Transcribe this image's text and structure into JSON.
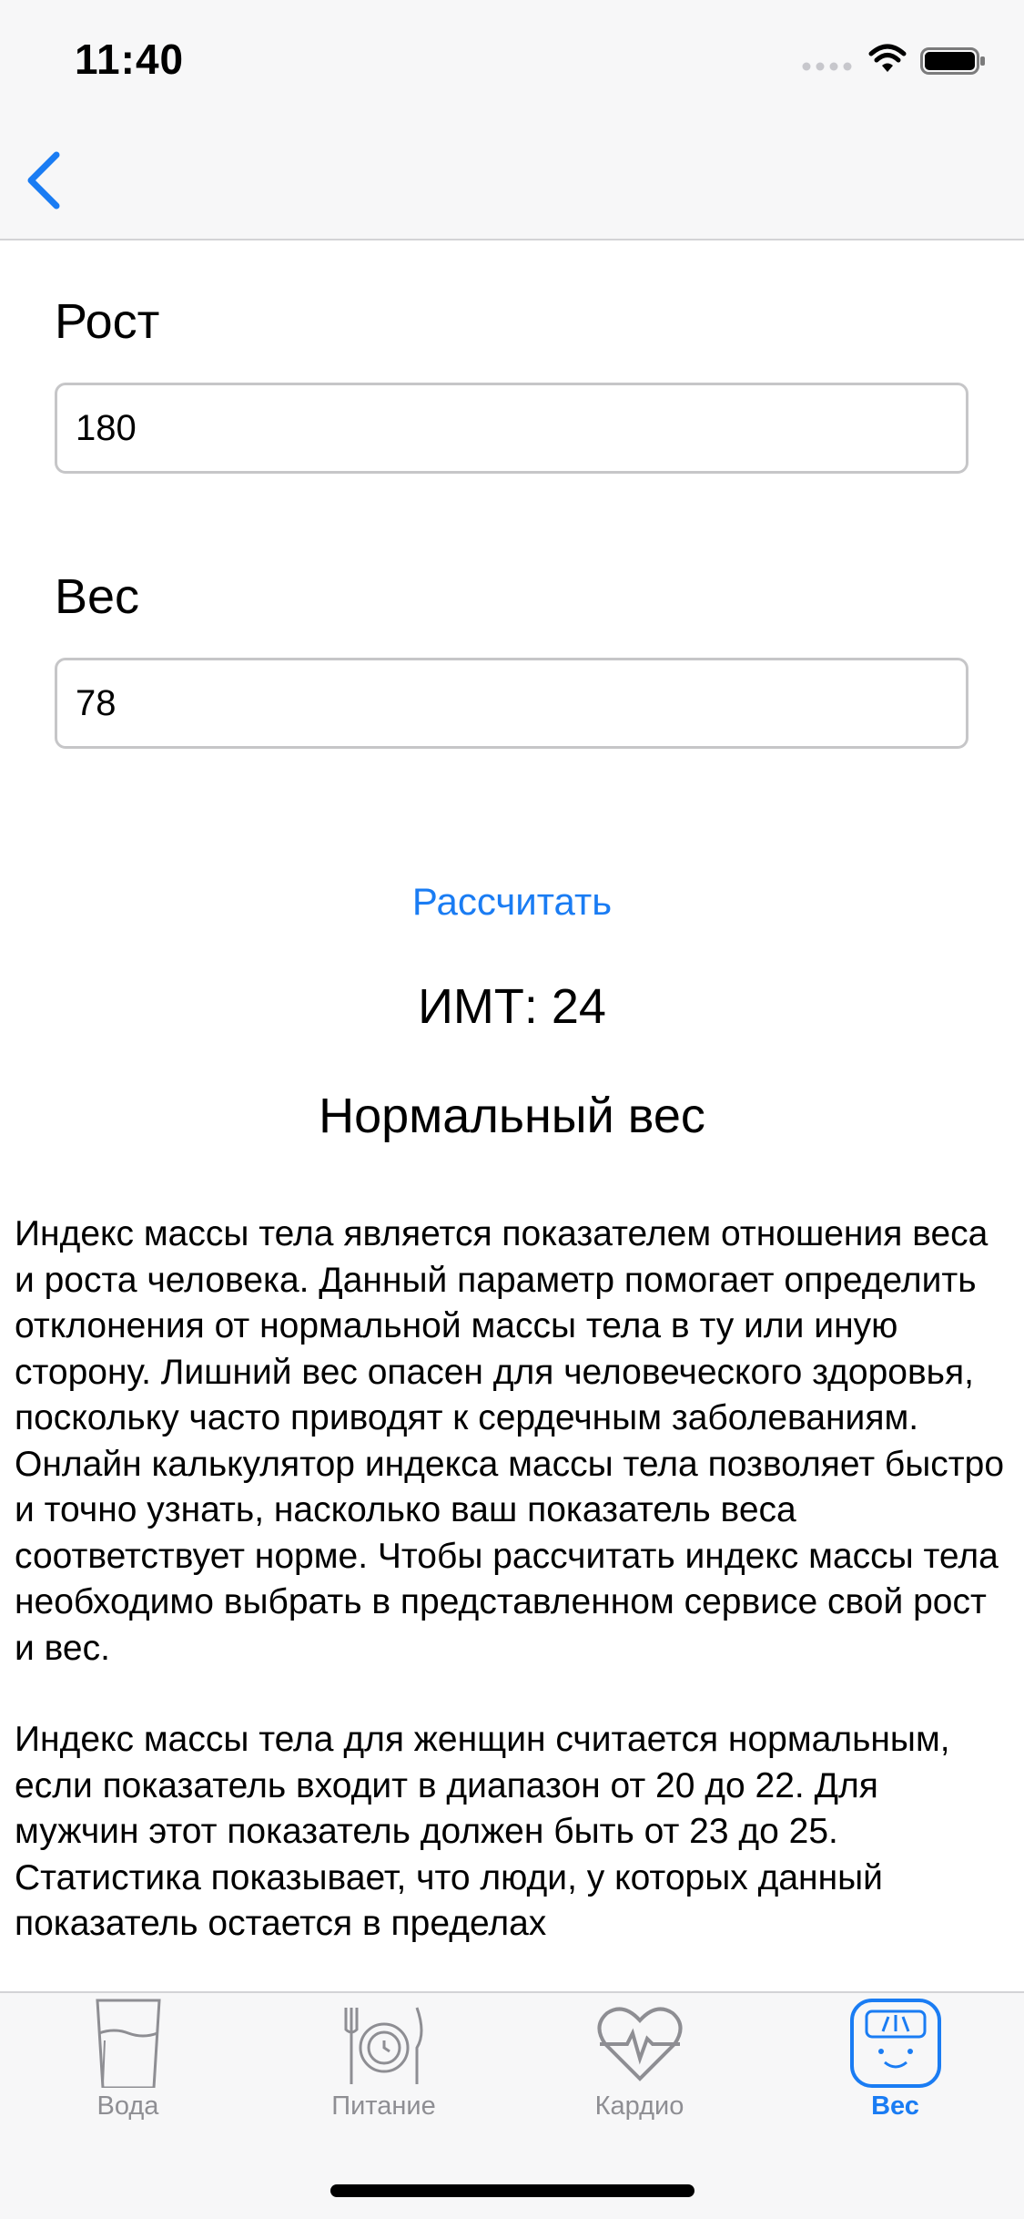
{
  "status_bar": {
    "time": "11:40"
  },
  "nav": {
    "back_icon": "chevron-left-icon"
  },
  "form": {
    "height_label": "Рост",
    "height_value": "180",
    "weight_label": "Вес",
    "weight_value": "78"
  },
  "calculate_label": "Рассчитать",
  "result": {
    "bmi": "ИМТ: 24",
    "category": "Нормальный вес"
  },
  "info": {
    "paragraph1": "Индекс массы тела является показателем отношения веса и роста человека. Данный параметр помогает определить отклонения от нормальной массы тела в ту или иную сторону. Лишний вес опасен для человеческого здоровья, поскольку часто приводят к сердечным заболеваниям. Онлайн калькулятор индекса массы тела позволяет быстро и точно узнать, насколько ваш показатель веса соответствует норме. Чтобы рассчитать индекс массы тела необходимо выбрать в представленном сервисе свой рост и вес.",
    "paragraph2": "Индекс массы тела для женщин считается нормальным, если показатель входит в диапазон от 20 до 22. Для мужчин этот показатель должен быть от 23 до 25. Статистика показывает, что люди, у которых данный показатель остается в пределах"
  },
  "tabs": [
    {
      "label": "Вода",
      "icon": "water-glass-icon",
      "active": false
    },
    {
      "label": "Питание",
      "icon": "plate-cutlery-icon",
      "active": false
    },
    {
      "label": "Кардио",
      "icon": "heart-pulse-icon",
      "active": false
    },
    {
      "label": "Вес",
      "icon": "scale-icon",
      "active": true
    }
  ],
  "colors": {
    "accent": "#1a7cf3",
    "inactive_tab": "#8e8e93",
    "bar_background": "#f7f7f8"
  }
}
